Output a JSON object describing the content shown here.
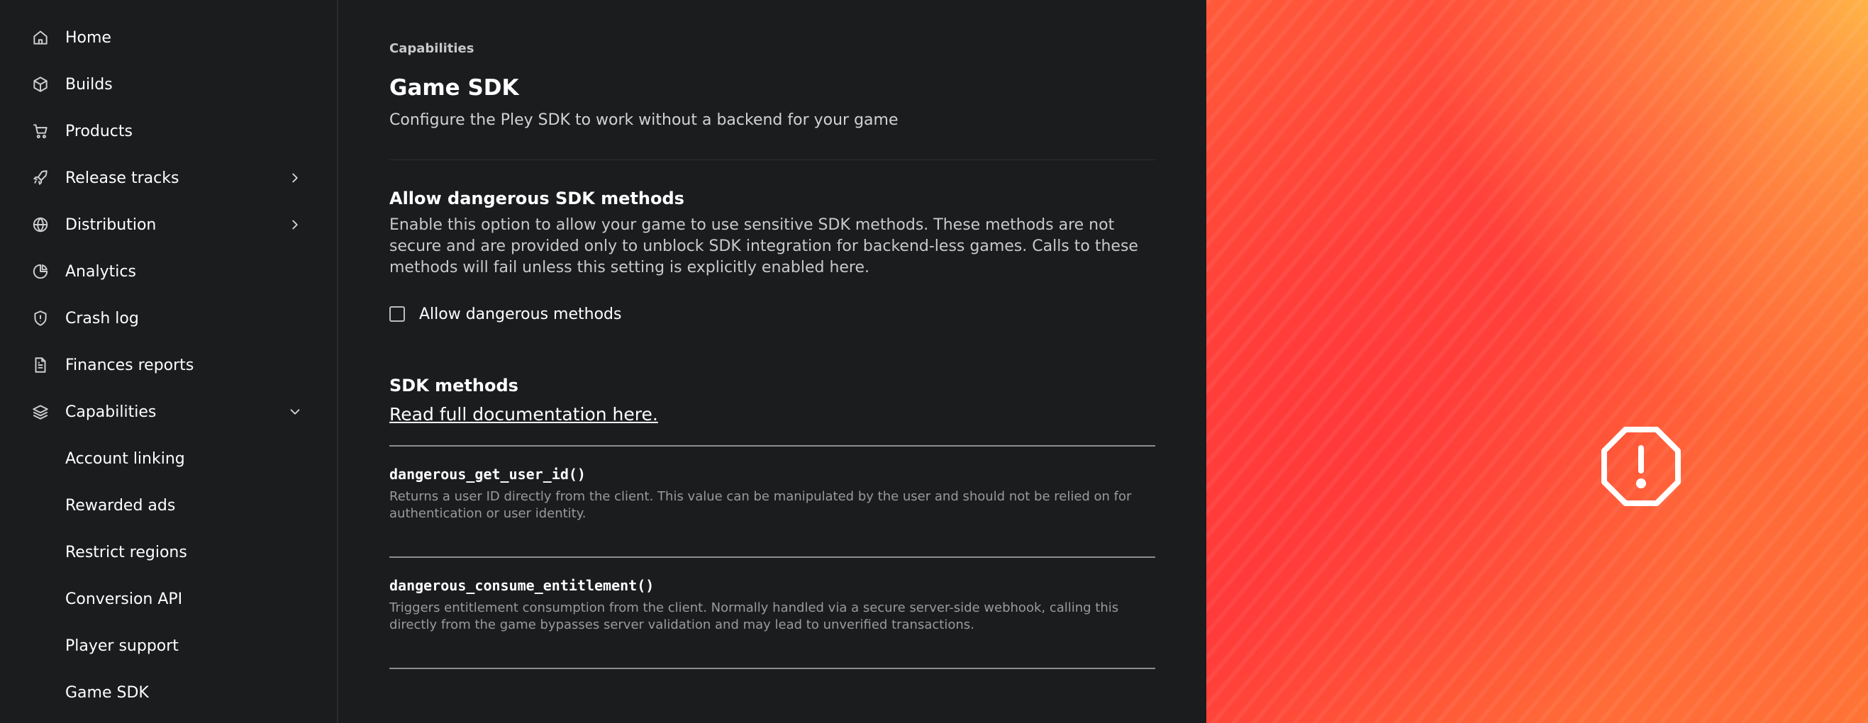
{
  "sidebar": {
    "items": [
      {
        "label": "Home",
        "icon": "home-icon"
      },
      {
        "label": "Builds",
        "icon": "box-icon"
      },
      {
        "label": "Products",
        "icon": "cart-icon"
      },
      {
        "label": "Release tracks",
        "icon": "rocket-icon",
        "expandable": true
      },
      {
        "label": "Distribution",
        "icon": "globe-icon",
        "expandable": true
      },
      {
        "label": "Analytics",
        "icon": "pie-chart-icon"
      },
      {
        "label": "Crash log",
        "icon": "shield-icon"
      },
      {
        "label": "Finances reports",
        "icon": "document-icon"
      },
      {
        "label": "Capabilities",
        "icon": "layers-icon",
        "expanded": true
      }
    ],
    "sub_items": [
      {
        "label": "Account linking"
      },
      {
        "label": "Rewarded ads"
      },
      {
        "label": "Restrict regions"
      },
      {
        "label": "Conversion API"
      },
      {
        "label": "Player support"
      },
      {
        "label": "Game SDK",
        "active": true
      }
    ]
  },
  "main": {
    "eyebrow": "Capabilities",
    "title": "Game SDK",
    "subtitle": "Configure the Pley SDK to work without a backend for your game",
    "dangerous": {
      "title": "Allow dangerous SDK methods",
      "description": "Enable this option to allow your game to use sensitive SDK methods. These methods are not secure and are provided only to unblock SDK integration for backend-less games. Calls to these methods will fail unless this setting is explicitly enabled here.",
      "checkbox_label": "Allow dangerous methods",
      "checked": false
    },
    "sdk_methods": {
      "title": "SDK methods",
      "doc_link": "Read full documentation here.",
      "methods": [
        {
          "name": "dangerous_get_user_id()",
          "description": "Returns a user ID directly from the client. This value can be manipulated by the user and should not be relied on for authentication or user identity."
        },
        {
          "name": "dangerous_consume_entitlement()",
          "description": "Triggers entitlement consumption from the client. Normally handled via a secure server-side webhook, calling this directly from the game bypasses server validation and may lead to unverified transactions."
        }
      ]
    }
  },
  "art_panel": {
    "icon": "warning-octagon-icon",
    "colors": {
      "primary": "#ff3b3b",
      "secondary": "#ff8a2a"
    }
  }
}
